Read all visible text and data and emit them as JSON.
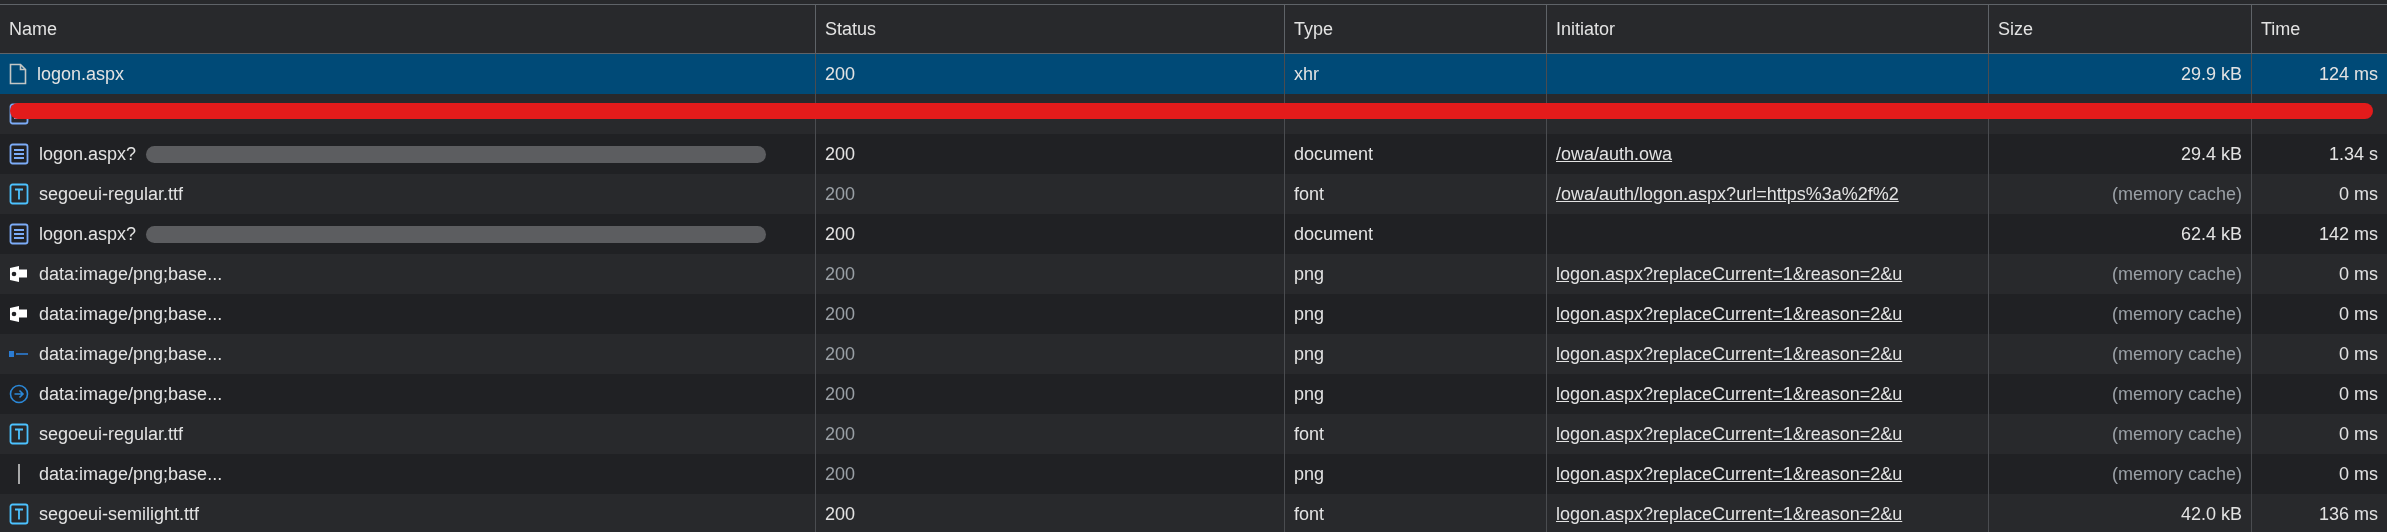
{
  "columns": [
    "Name",
    "Status",
    "Type",
    "Initiator",
    "Size",
    "Time"
  ],
  "rows": [
    {
      "kind": "file",
      "name": "logon.aspx",
      "blurred": false,
      "status": "200",
      "type": "xhr",
      "size": "29.9 kB",
      "cached": false,
      "time": "124 ms",
      "selected": true,
      "redacted": false
    },
    {
      "kind": "document",
      "blurred": false,
      "selected": false,
      "redacted": true
    },
    {
      "kind": "document",
      "name": "logon.aspx?",
      "blurred": true,
      "status": "200",
      "type": "document",
      "initiator": "/owa/auth.owa",
      "size": "29.4 kB",
      "cached": false,
      "time": "1.34 s",
      "selected": false,
      "redacted": false
    },
    {
      "kind": "font",
      "name": "segoeui-regular.ttf",
      "blurred": false,
      "status": "200",
      "type": "font",
      "initiator": "/owa/auth/logon.aspx?url=https%3a%2f%2",
      "size": "(memory cache)",
      "cached": true,
      "time": "0 ms",
      "selected": false,
      "redacted": false
    },
    {
      "kind": "document",
      "name": "logon.aspx?",
      "blurred": true,
      "status": "200",
      "type": "document",
      "size": "62.4 kB",
      "cached": false,
      "time": "142 ms",
      "selected": false,
      "redacted": false
    },
    {
      "kind": "envelope",
      "name": "data:image/png;base...",
      "blurred": false,
      "status": "200",
      "type": "png",
      "initiator": "logon.aspx?replaceCurrent=1&reason=2&u",
      "size": "(memory cache)",
      "cached": true,
      "time": "0 ms",
      "selected": false,
      "redacted": false
    },
    {
      "kind": "envelope",
      "name": "data:image/png;base...",
      "blurred": false,
      "status": "200",
      "type": "png",
      "initiator": "logon.aspx?replaceCurrent=1&reason=2&u",
      "size": "(memory cache)",
      "cached": true,
      "time": "0 ms",
      "selected": false,
      "redacted": false
    },
    {
      "kind": "banner",
      "name": "data:image/png;base...",
      "blurred": false,
      "status": "200",
      "type": "png",
      "initiator": "logon.aspx?replaceCurrent=1&reason=2&u",
      "size": "(memory cache)",
      "cached": true,
      "time": "0 ms",
      "selected": false,
      "redacted": false
    },
    {
      "kind": "arrow",
      "name": "data:image/png;base...",
      "blurred": false,
      "status": "200",
      "type": "png",
      "initiator": "logon.aspx?replaceCurrent=1&reason=2&u",
      "size": "(memory cache)",
      "cached": true,
      "time": "0 ms",
      "selected": false,
      "redacted": false
    },
    {
      "kind": "font",
      "name": "segoeui-regular.ttf",
      "blurred": false,
      "status": "200",
      "type": "font",
      "initiator": "logon.aspx?replaceCurrent=1&reason=2&u",
      "size": "(memory cache)",
      "cached": true,
      "time": "0 ms",
      "selected": false,
      "redacted": false
    },
    {
      "kind": "line",
      "name": "data:image/png;base...",
      "blurred": false,
      "status": "200",
      "type": "png",
      "initiator": "logon.aspx?replaceCurrent=1&reason=2&u",
      "size": "(memory cache)",
      "cached": true,
      "time": "0 ms",
      "selected": false,
      "redacted": false
    },
    {
      "kind": "font",
      "name": "segoeui-semilight.ttf",
      "blurred": false,
      "status": "200",
      "type": "font",
      "initiator": "logon.aspx?replaceCurrent=1&reason=2&u",
      "size": "42.0 kB",
      "cached": false,
      "time": "136 ms",
      "selected": false,
      "redacted": false
    }
  ]
}
